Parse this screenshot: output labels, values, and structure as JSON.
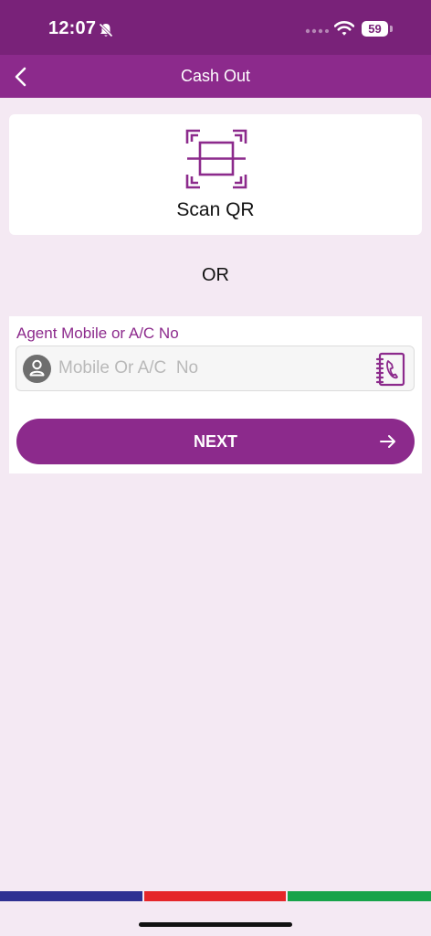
{
  "status": {
    "time": "12:07",
    "battery": "59"
  },
  "header": {
    "title": "Cash Out"
  },
  "scan": {
    "label": "Scan QR"
  },
  "divider": {
    "text": "OR"
  },
  "form": {
    "field_label": "Agent Mobile or A/C No",
    "placeholder": "Mobile Or A/C  No",
    "value": "",
    "next_label": "NEXT"
  },
  "icons": {
    "back": "chevron-left-icon",
    "scan": "qr-scan-icon",
    "avatar": "person-icon",
    "contacts": "contact-book-icon",
    "next": "arrow-right-icon",
    "bell": "bell-slash-icon",
    "wifi": "wifi-icon"
  },
  "colors": {
    "status_bar": "#792279",
    "brand": "#8c2a8c",
    "background": "#f4e9f3",
    "strip_blue": "#2e3192",
    "strip_red": "#e52629",
    "strip_green": "#17a34a"
  }
}
